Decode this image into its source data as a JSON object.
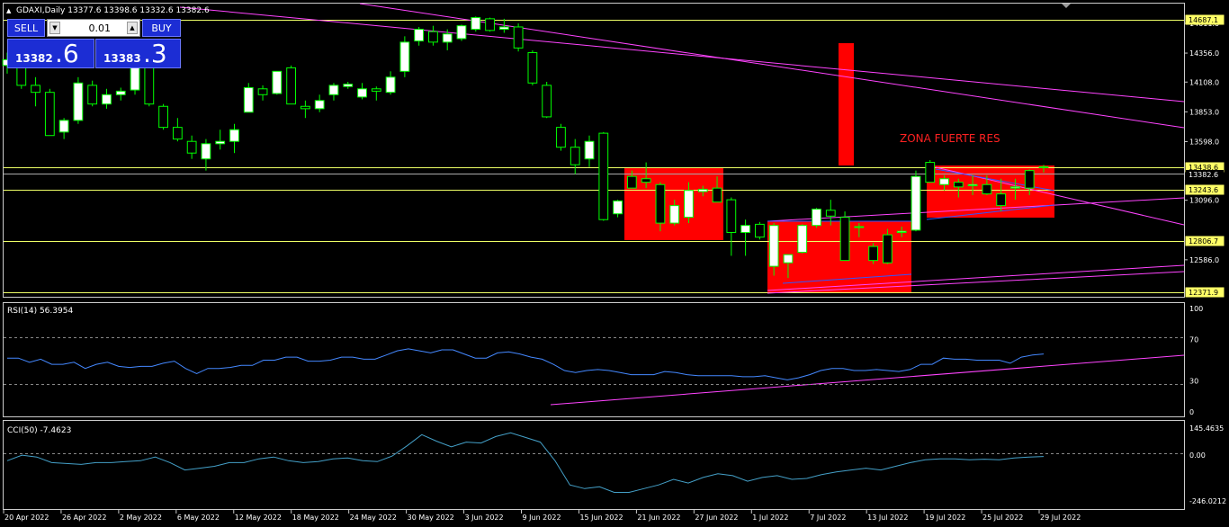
{
  "header": {
    "symbol_line": "GDAXI,Daily  13377.6 13398.6 13332.6 13382.6",
    "arrow": "▲"
  },
  "trade_panel": {
    "sell_label": "SELL",
    "buy_label": "BUY",
    "lot": "0.01",
    "sell_main": "13382",
    "sell_big": ".6",
    "buy_main": "13383",
    "buy_big": ".3"
  },
  "colors": {
    "bull": "#ffffff",
    "bear": "#ffffff",
    "wick": "#00ff00",
    "zone": "#ff0000",
    "hline": "#eeff66",
    "trend": "#ff44ff",
    "blue": "#3355ff",
    "rsi": "#4488ff",
    "cci": "#44a0c8"
  },
  "chart_data": [
    {
      "type": "candlestick",
      "title": "GDAXI,Daily",
      "ohlc_header": [
        13377.6,
        13398.6,
        13332.6,
        13382.6
      ],
      "ylim": [
        12300,
        14780
      ],
      "y_ticks": [
        14611.0,
        14356.0,
        14108.0,
        13853.0,
        13598.0,
        13096.0,
        12586.0
      ],
      "x_labels": [
        "20 Apr 2022",
        "26 Apr 2022",
        "2 May 2022",
        "6 May 2022",
        "12 May 2022",
        "18 May 2022",
        "24 May 2022",
        "30 May 2022",
        "3 Jun 2022",
        "9 Jun 2022",
        "15 Jun 2022",
        "21 Jun 2022",
        "27 Jun 2022",
        "1 Jul 2022",
        "7 Jul 2022",
        "13 Jul 2022",
        "19 Jul 2022",
        "25 Jul 2022",
        "29 Jul 2022"
      ],
      "levels": [
        {
          "label": "14687.1",
          "value": 14687.1
        },
        {
          "label": "13438.6",
          "value": 13438.6
        },
        {
          "label": "13382.6",
          "value": 13382.6
        },
        {
          "label": "13243.6",
          "value": 13243.6
        },
        {
          "label": "12806.7",
          "value": 12806.7
        },
        {
          "label": "12371.9",
          "value": 12371.9
        }
      ],
      "annotation": "ZONA FUERTE RES",
      "candles": [
        [
          14250,
          14360,
          14180,
          14300
        ],
        [
          14330,
          14380,
          14050,
          14080
        ],
        [
          14080,
          14150,
          13900,
          14020
        ],
        [
          14020,
          14050,
          13650,
          13650
        ],
        [
          13680,
          13800,
          13620,
          13780
        ],
        [
          13780,
          14150,
          13750,
          14100
        ],
        [
          14080,
          14120,
          13900,
          13920
        ],
        [
          13920,
          14050,
          13880,
          14000
        ],
        [
          14000,
          14060,
          13950,
          14030
        ],
        [
          14040,
          14350,
          14000,
          14300
        ],
        [
          14280,
          14300,
          13900,
          13920
        ],
        [
          13900,
          13920,
          13700,
          13720
        ],
        [
          13720,
          13800,
          13600,
          13620
        ],
        [
          13600,
          13650,
          13450,
          13500
        ],
        [
          13450,
          13620,
          13350,
          13580
        ],
        [
          13580,
          13700,
          13530,
          13600
        ],
        [
          13600,
          13750,
          13500,
          13700
        ],
        [
          13850,
          14100,
          13850,
          14060
        ],
        [
          14050,
          14080,
          13950,
          14000
        ],
        [
          14010,
          14200,
          14000,
          14200
        ],
        [
          14230,
          14250,
          13920,
          13920
        ],
        [
          13900,
          13950,
          13800,
          13880
        ],
        [
          13880,
          14000,
          13850,
          13950
        ],
        [
          14000,
          14100,
          13950,
          14080
        ],
        [
          14070,
          14110,
          14050,
          14090
        ],
        [
          13980,
          14100,
          13960,
          14050
        ],
        [
          14050,
          14070,
          13950,
          14030
        ],
        [
          14020,
          14200,
          14000,
          14150
        ],
        [
          14200,
          14500,
          14150,
          14450
        ],
        [
          14460,
          14580,
          14420,
          14560
        ],
        [
          14540,
          14590,
          14420,
          14450
        ],
        [
          14450,
          14560,
          14380,
          14520
        ],
        [
          14480,
          14600,
          14460,
          14590
        ],
        [
          14560,
          14670,
          14540,
          14660
        ],
        [
          14650,
          14660,
          14540,
          14550
        ],
        [
          14560,
          14650,
          14530,
          14580
        ],
        [
          14580,
          14610,
          14370,
          14400
        ],
        [
          14360,
          14380,
          14080,
          14100
        ],
        [
          14080,
          14110,
          13800,
          13810
        ],
        [
          13720,
          13750,
          13520,
          13550
        ],
        [
          13550,
          13620,
          13320,
          13400
        ],
        [
          13450,
          13650,
          13380,
          13600
        ],
        [
          13670,
          13680,
          12920,
          12930
        ],
        [
          12980,
          13100,
          12950,
          13090
        ],
        [
          13300,
          13350,
          13250,
          13200
        ],
        [
          13280,
          13420,
          13200,
          13250
        ],
        [
          13230,
          13250,
          12830,
          12900
        ],
        [
          12900,
          13100,
          12880,
          13050
        ],
        [
          12950,
          13250,
          12900,
          13180
        ],
        [
          13170,
          13220,
          13130,
          13190
        ],
        [
          13200,
          13300,
          13080,
          13080
        ],
        [
          13100,
          13120,
          12620,
          12820
        ],
        [
          12820,
          12930,
          12620,
          12880
        ],
        [
          12890,
          12910,
          12760,
          12780
        ],
        [
          12530,
          12900,
          12450,
          12880
        ],
        [
          12560,
          12620,
          12430,
          12630
        ],
        [
          12650,
          12890,
          12640,
          12880
        ],
        [
          12880,
          13030,
          12860,
          13020
        ],
        [
          13010,
          13100,
          12880,
          12960
        ],
        [
          12950,
          13000,
          12580,
          12580
        ],
        [
          12870,
          12900,
          12780,
          12870
        ],
        [
          12700,
          12730,
          12550,
          12580
        ],
        [
          12800,
          12850,
          12550,
          12560
        ],
        [
          12820,
          12870,
          12780,
          12830
        ],
        [
          12840,
          13350,
          12830,
          13300
        ],
        [
          13420,
          13440,
          13250,
          13250
        ],
        [
          13230,
          13310,
          13180,
          13280
        ],
        [
          13250,
          13280,
          13120,
          13210
        ],
        [
          13220,
          13310,
          13140,
          13230
        ],
        [
          13230,
          13310,
          13140,
          13150
        ],
        [
          13150,
          13280,
          13000,
          13050
        ],
        [
          13200,
          13280,
          13100,
          13210
        ],
        [
          13350,
          13360,
          13140,
          13200
        ],
        [
          13377.6,
          13398.6,
          13332.6,
          13382.6
        ]
      ]
    },
    {
      "type": "line",
      "title": "RSI(14) 56.3954",
      "ylim": [
        0,
        100
      ],
      "y_ticks": [
        100,
        70,
        30,
        0
      ],
      "values": [
        52,
        52,
        48,
        51,
        46,
        46,
        48,
        42,
        46,
        48,
        44,
        43,
        44,
        44,
        47,
        49,
        42,
        37,
        42,
        42,
        43,
        45,
        45,
        50,
        50,
        53,
        53,
        49,
        49,
        50,
        53,
        53,
        51,
        51,
        55,
        59,
        61,
        59,
        57,
        60,
        60,
        56,
        52,
        52,
        57,
        58,
        56,
        53,
        51,
        46,
        40,
        38,
        40,
        41,
        40,
        38,
        36,
        36,
        36,
        39,
        38,
        36,
        35,
        35,
        35,
        35,
        34,
        34,
        35,
        33,
        31,
        33,
        36,
        40,
        42,
        42,
        40,
        40,
        41,
        40,
        39,
        41,
        46,
        46,
        52,
        51,
        51,
        50,
        50,
        50,
        47,
        53,
        55,
        56
      ]
    },
    {
      "type": "line",
      "title": "CCI(50) -7.4623",
      "ylim": [
        -246.0212,
        145.4635
      ],
      "y_ticks": [
        145.4635,
        0.0,
        -246.0212
      ],
      "values": [
        -30,
        0,
        -10,
        -40,
        -45,
        -50,
        -40,
        -40,
        -35,
        -30,
        -10,
        -40,
        -80,
        -70,
        -60,
        -40,
        -40,
        -20,
        -10,
        -30,
        -40,
        -35,
        -20,
        -15,
        -30,
        -35,
        -5,
        50,
        110,
        75,
        45,
        70,
        65,
        100,
        120,
        95,
        70,
        -30,
        -160,
        -180,
        -170,
        -200,
        -200,
        -180,
        -160,
        -130,
        -150,
        -120,
        -100,
        -110,
        -140,
        -120,
        -110,
        -130,
        -125,
        -105,
        -90,
        -80,
        -70,
        -80,
        -60,
        -40,
        -25,
        -20,
        -20,
        -25,
        -22,
        -25,
        -15,
        -10,
        -7.4623
      ]
    }
  ]
}
